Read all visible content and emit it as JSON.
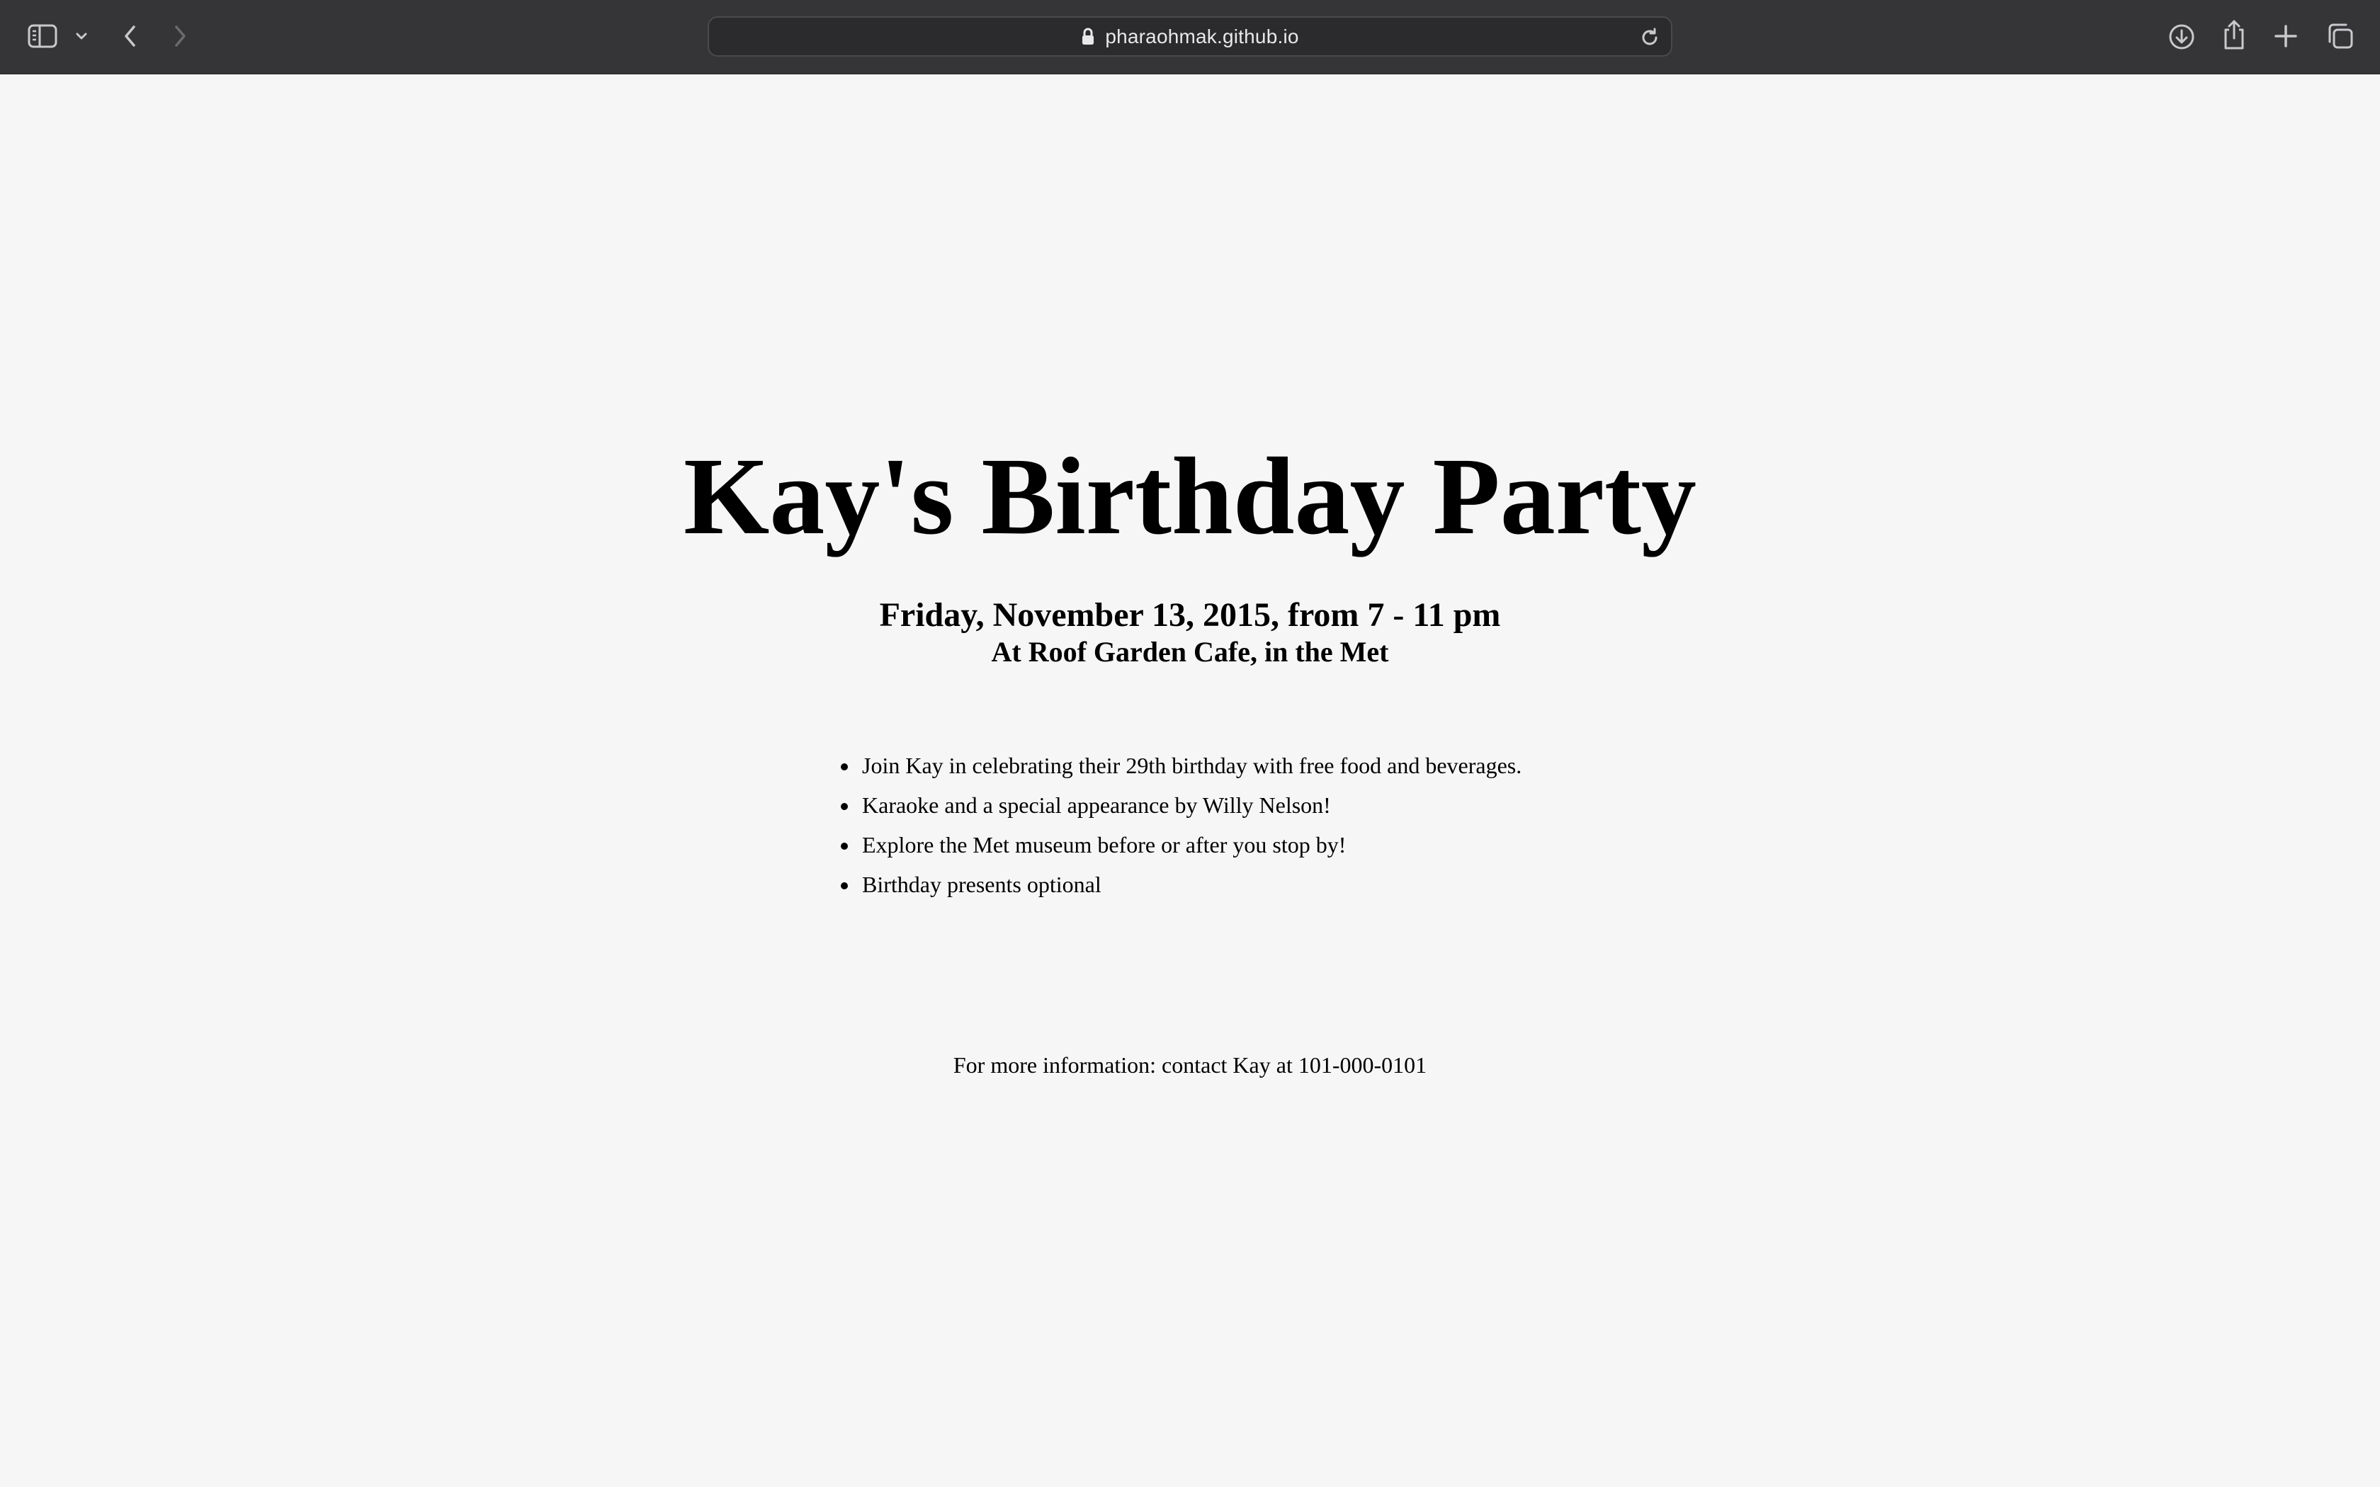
{
  "browser": {
    "url": "pharaohmak.github.io",
    "icons": {
      "sidebar": "sidebar-icon",
      "sidebar_menu": "chevron-down-icon",
      "back": "chevron-left-icon",
      "forward": "chevron-right-icon",
      "secure": "lock-icon",
      "reload": "reload-icon",
      "downloads": "download-icon",
      "share": "share-icon",
      "new_tab": "plus-icon",
      "tab_overview": "tabs-icon"
    }
  },
  "invitation": {
    "title": "Kay's Birthday Party",
    "date_time": "Friday, November 13, 2015, from 7 - 11 pm",
    "location": "At Roof Garden Cafe, in the Met",
    "details": [
      "Join Kay in celebrating their 29th birthday with free food and beverages.",
      "Karaoke and a special appearance by Willy Nelson!",
      "Explore the Met museum before or after you stop by!",
      "Birthday presents optional"
    ],
    "contact": "For more information: contact Kay at 101-000-0101"
  }
}
